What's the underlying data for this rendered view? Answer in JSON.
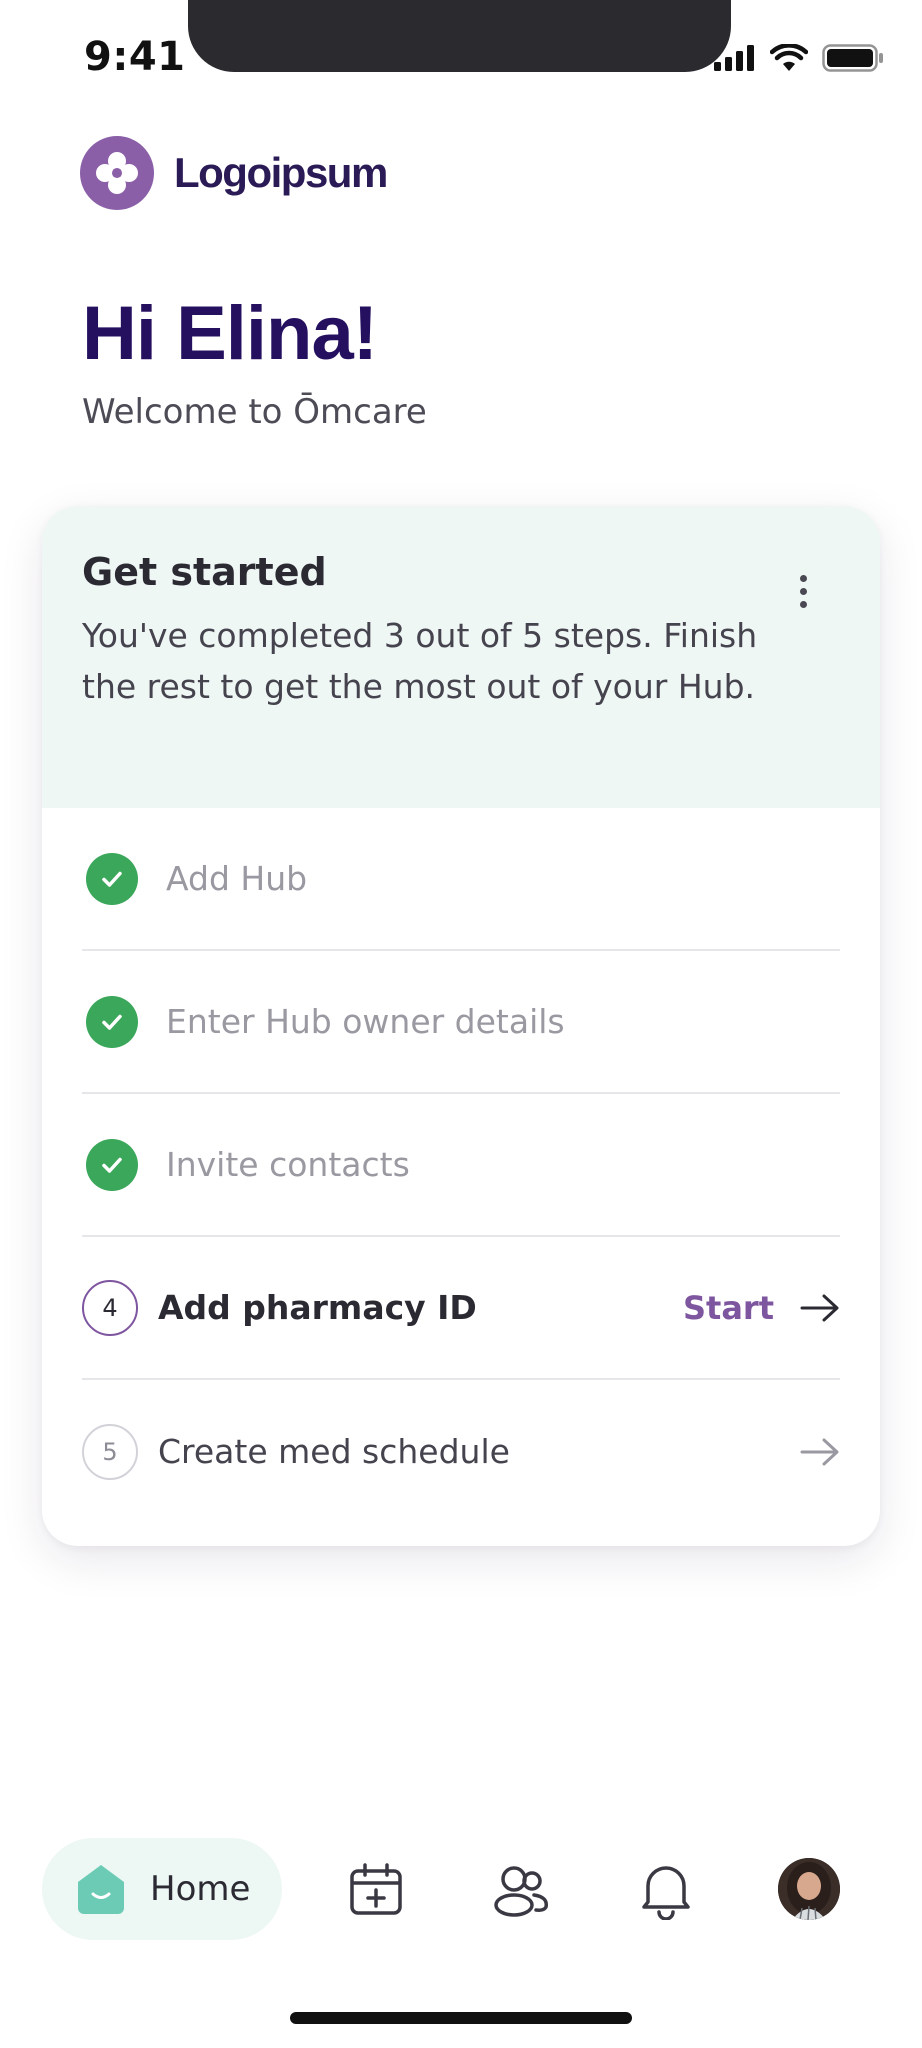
{
  "status_bar": {
    "time": "9:41"
  },
  "brand": {
    "name": "Logoipsum"
  },
  "greeting": {
    "title": "Hi Elina!",
    "subtitle": "Welcome to Ōmcare"
  },
  "card": {
    "title": "Get started",
    "description": "You've completed 3 out of 5 steps. Finish the rest to get the most out of your Hub.",
    "steps": [
      {
        "label": "Add Hub",
        "state": "done"
      },
      {
        "label": "Enter Hub owner details",
        "state": "done"
      },
      {
        "label": "Invite contacts",
        "state": "done"
      },
      {
        "number": "4",
        "label": "Add pharmacy ID",
        "state": "active",
        "action": "Start"
      },
      {
        "number": "5",
        "label": "Create med schedule",
        "state": "pending"
      }
    ]
  },
  "tab_bar": {
    "home_label": "Home",
    "items": [
      "home-icon",
      "calendar-add-icon",
      "contacts-icon",
      "bell-icon",
      "avatar"
    ]
  },
  "colors": {
    "brand_purple": "#8a5fa8",
    "heading_purple": "#24105f",
    "success_green": "#3aa75a",
    "accent_purple": "#7e559f",
    "header_tint": "#eff7f5",
    "home_teal": "#6ccbb5"
  }
}
